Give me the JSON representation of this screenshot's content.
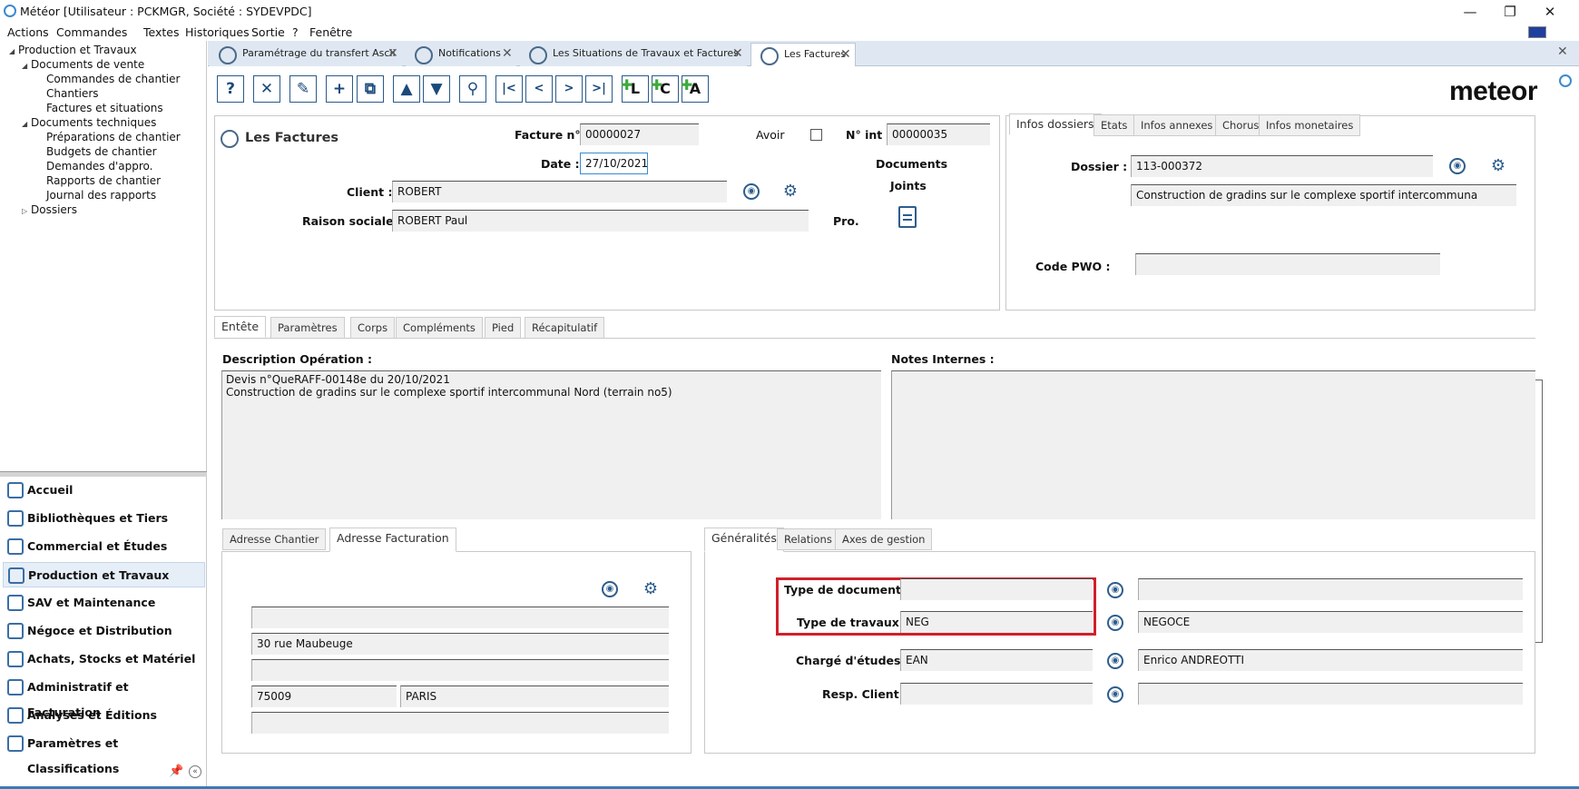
{
  "window": {
    "title": "Météor [Utilisateur : PCKMGR, Société : SYDEVPDC]",
    "minimize": "—",
    "restore": "❐",
    "close": "✕"
  },
  "menu": [
    "Actions",
    "Commandes",
    "Textes",
    "Historiques",
    "Sortie",
    "?",
    "Fenêtre"
  ],
  "tree": [
    {
      "label": "Production et Travaux",
      "level": 0,
      "expanded": true
    },
    {
      "label": "Documents de vente",
      "level": 1,
      "expanded": true
    },
    {
      "label": "Commandes de chantier",
      "level": 2
    },
    {
      "label": "Chantiers",
      "level": 2
    },
    {
      "label": "Factures et situations",
      "level": 2
    },
    {
      "label": "Documents techniques",
      "level": 1,
      "expanded": true
    },
    {
      "label": "Préparations de chantier",
      "level": 2
    },
    {
      "label": "Budgets de chantier",
      "level": 2
    },
    {
      "label": "Demandes d'appro.",
      "level": 2
    },
    {
      "label": "Rapports de chantier",
      "level": 2
    },
    {
      "label": "Journal des rapports",
      "level": 2
    },
    {
      "label": "Dossiers",
      "level": 1,
      "expanded": false
    }
  ],
  "nav": [
    {
      "label": "Accueil",
      "icon": "home-icon"
    },
    {
      "label": "Bibliothèques et Tiers",
      "icon": "books-icon"
    },
    {
      "label": "Commercial et Études",
      "icon": "chart-icon"
    },
    {
      "label": "Production et Travaux",
      "icon": "worker-icon",
      "selected": true
    },
    {
      "label": "SAV et Maintenance",
      "icon": "wrench-icon"
    },
    {
      "label": "Négoce et Distribution",
      "icon": "box-icon"
    },
    {
      "label": "Achats, Stocks et Matériel",
      "icon": "cart-icon"
    },
    {
      "label": "Administratif et Facturation",
      "icon": "money-icon"
    },
    {
      "label": "Analyses et Éditions",
      "icon": "report-icon"
    },
    {
      "label": "Paramètres et Classifications",
      "icon": "settings-icon"
    }
  ],
  "doc_tabs": [
    {
      "label": "Paramétrage du transfert Ascii"
    },
    {
      "label": "Notifications"
    },
    {
      "label": "Les Situations de Travaux et Factures"
    },
    {
      "label": "Les Factures",
      "active": true
    }
  ],
  "toolbar": {
    "help": "?",
    "delete": "✕",
    "edit": "✎",
    "add": "+",
    "copy": "⧉",
    "up": "▲",
    "down": "▼",
    "search": "⚲",
    "first": "|<",
    "prev": "<",
    "next": ">",
    "last": ">|",
    "add_l": "L",
    "add_c": "C",
    "add_a": "A"
  },
  "brand": "meteor",
  "header": {
    "title": "Les Factures",
    "facture_label": "Facture n°",
    "facture_value": "00000027",
    "avoir_label": "Avoir",
    "nint_label": "N° int :",
    "nint_value": "00000035",
    "date_label": "Date :",
    "date_value": "27/10/2021",
    "documents_label": "Documents",
    "joints_label": "Joints",
    "client_label": "Client :",
    "client_value": "ROBERT",
    "raison_label": "Raison sociale :",
    "raison_value": "ROBERT Paul",
    "pro_label": "Pro."
  },
  "info_tabs": [
    "Infos dossiers",
    "Etats",
    "Infos annexes",
    "Chorus",
    "Infos monetaires"
  ],
  "info": {
    "dossier_label": "Dossier :",
    "dossier_value": "113-000372",
    "dossier_desc": "Construction de gradins sur le complexe sportif intercommuna",
    "pwo_label": "Code PWO :",
    "pwo_value": ""
  },
  "main_tabs": [
    "Entête",
    "Paramètres",
    "Corps",
    "Compléments",
    "Pied",
    "Récapitulatif"
  ],
  "description": {
    "label": "Description Opération :",
    "text": "Devis n°QueRAFF-00148e du 20/10/2021\nConstruction de gradins sur le complexe sportif intercommunal Nord (terrain no5)"
  },
  "notes": {
    "label": "Notes Internes :",
    "text": ""
  },
  "addr_tabs": [
    "Adresse Chantier",
    "Adresse Facturation"
  ],
  "address": {
    "line1": "",
    "line2": "30 rue Maubeuge",
    "line3": "",
    "cp": "75009",
    "city": "PARIS",
    "line5": ""
  },
  "gen_tabs": [
    "Généralités",
    "Relations",
    "Axes de gestion"
  ],
  "gen": {
    "type_doc_label": "Type de document :",
    "type_doc_code": "",
    "type_doc_desc": "",
    "type_trav_label": "Type de travaux :",
    "type_trav_code": "NEG",
    "type_trav_desc": "NEGOCE",
    "charge_label": "Chargé d'études :",
    "charge_code": "EAN",
    "charge_desc": "Enrico ANDREOTTI",
    "resp_label": "Resp. Client :",
    "resp_code": "",
    "resp_desc": ""
  },
  "colors": {
    "highlight": "#d0202a",
    "accent": "#2d5d8d",
    "tabs_bg": "#dfe8f2"
  }
}
